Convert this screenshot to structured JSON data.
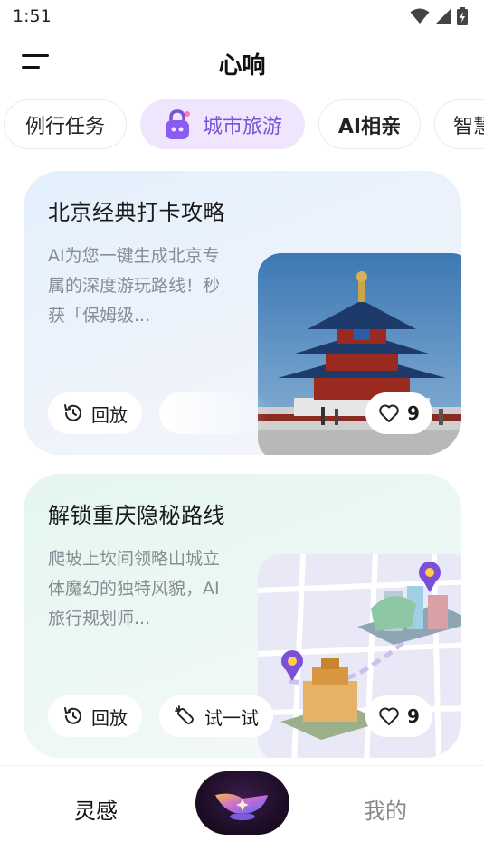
{
  "status_bar": {
    "time": "1:51"
  },
  "header": {
    "title": "心响"
  },
  "tabs": [
    {
      "label": "例行任务"
    },
    {
      "label": "城市旅游"
    },
    {
      "label": "AI相亲"
    },
    {
      "label": "智慧"
    }
  ],
  "cards": [
    {
      "title": "北京经典打卡攻略",
      "description": "AI为您一键生成北京专属的深度游玩路线！秒获「保姆级...",
      "replay_label": "回放",
      "likes": "9"
    },
    {
      "title": "解锁重庆隐秘路线",
      "description": "爬坡上坎间领略山城立体魔幻的独特风貌，AI旅行规划师...",
      "replay_label": "回放",
      "try_label": "试一试",
      "likes": "9"
    }
  ],
  "bottom_nav": {
    "inspiration": "灵感",
    "mine": "我的"
  },
  "colors": {
    "accent": "#7a52d6",
    "active_tab_bg": "#efe6fd"
  }
}
